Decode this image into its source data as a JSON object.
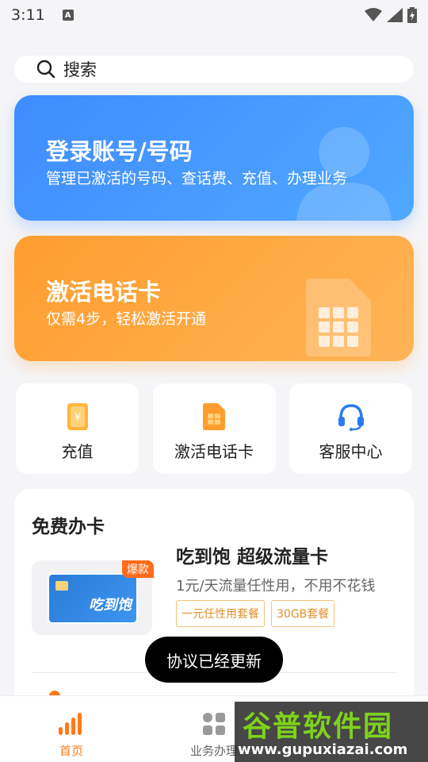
{
  "status_bar": {
    "time": "3:11",
    "notification_letter": "A"
  },
  "search": {
    "label": "搜索"
  },
  "banners": {
    "login": {
      "title": "登录账号/号码",
      "subtitle": "管理已激活的号码、查话费、充值、办理业务"
    },
    "activate": {
      "title": "激活电话卡",
      "subtitle": "仅需4步，轻松激活开通"
    }
  },
  "quick_actions": [
    {
      "label": "充值",
      "icon": "recharge-icon"
    },
    {
      "label": "激活电话卡",
      "icon": "sim-card-icon"
    },
    {
      "label": "客服中心",
      "icon": "headset-icon"
    }
  ],
  "free_card": {
    "title": "免费办卡",
    "product": {
      "badge": "爆款",
      "card_text": "吃到饱",
      "name": "吃到饱 超级流量卡",
      "description": "1元/天流量任性用，不用不花钱",
      "tags": [
        "一元任性用套餐",
        "30GB套餐"
      ]
    }
  },
  "toast": {
    "message": "协议已经更新"
  },
  "tabbar": {
    "items": [
      {
        "label": "首页",
        "icon": "home-bars-icon",
        "active": true
      },
      {
        "label": "业务办理",
        "icon": "grid-icon",
        "active": false
      }
    ]
  },
  "watermark": {
    "logo": "谷普软件园",
    "url": "www.gupuxiazai.com"
  },
  "colors": {
    "blue": "#3f8cff",
    "orange": "#ff9d2e",
    "accent": "#ff7a1a"
  }
}
